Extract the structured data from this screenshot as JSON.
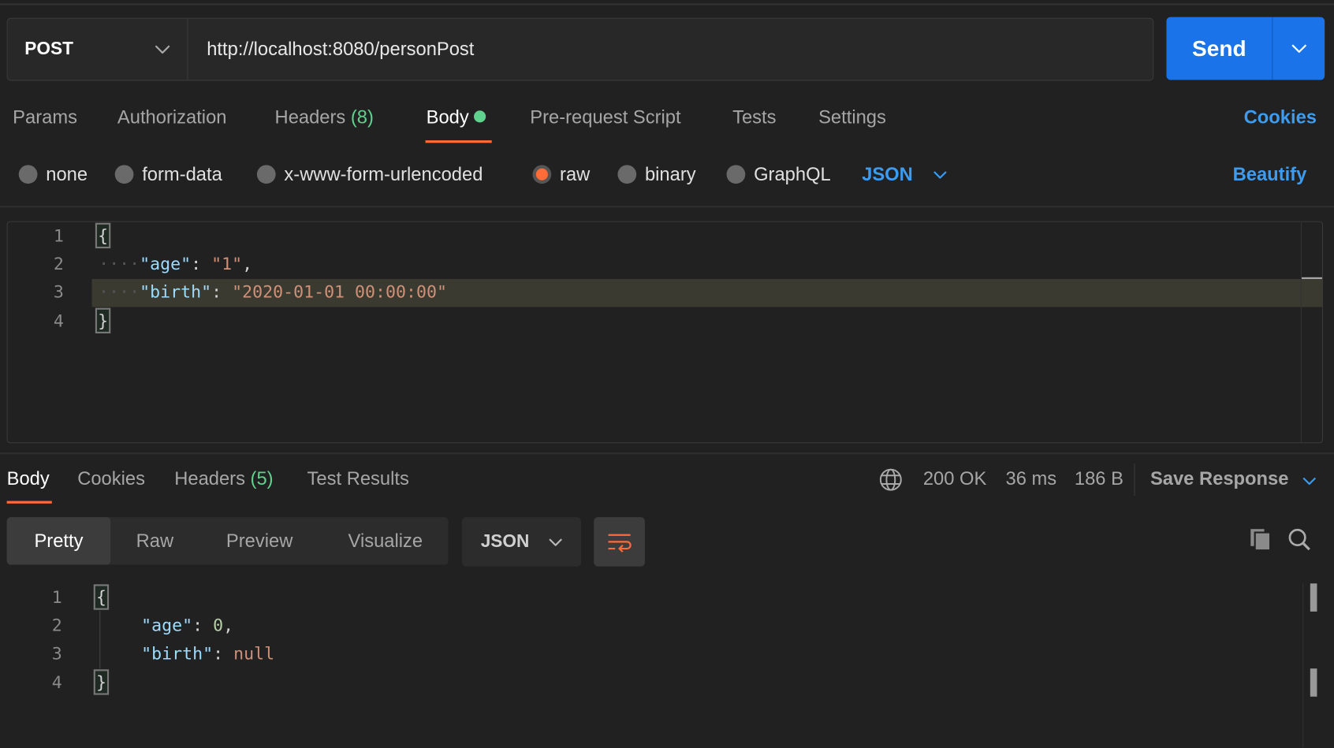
{
  "request": {
    "method": "POST",
    "url": "http://localhost:8080/personPost",
    "send_label": "Send"
  },
  "tabs": [
    {
      "label": "Params"
    },
    {
      "label": "Authorization"
    },
    {
      "label": "Headers",
      "count": "(8)"
    },
    {
      "label": "Body"
    },
    {
      "label": "Pre-request Script"
    },
    {
      "label": "Tests"
    },
    {
      "label": "Settings"
    }
  ],
  "cookies_label": "Cookies",
  "body_types": [
    "none",
    "form-data",
    "x-www-form-urlencoded",
    "raw",
    "binary",
    "GraphQL"
  ],
  "selected_body_type": "raw",
  "language": "JSON",
  "beautify_label": "Beautify",
  "request_body": {
    "line_numbers": [
      "1",
      "2",
      "3",
      "4"
    ],
    "open": "{",
    "close": "}",
    "age_key": "\"age\"",
    "age_val": "\"1\"",
    "birth_key": "\"birth\"",
    "birth_val": "\"2020-01-01 00:00:00\""
  },
  "response": {
    "tabs": [
      {
        "label": "Body"
      },
      {
        "label": "Cookies"
      },
      {
        "label": "Headers",
        "count": "(5)"
      },
      {
        "label": "Test Results"
      }
    ],
    "status": "200 OK",
    "time": "36 ms",
    "size": "186 B",
    "save_label": "Save Response",
    "views": [
      "Pretty",
      "Raw",
      "Preview",
      "Visualize"
    ],
    "format": "JSON",
    "body": {
      "line_numbers": [
        "1",
        "2",
        "3",
        "4"
      ],
      "open": "{",
      "close": "}",
      "age_key": "\"age\"",
      "age_val": "0",
      "birth_key": "\"birth\"",
      "birth_val": "null"
    }
  },
  "colors": {
    "accent": "#ff6c37",
    "send": "#1a73e8",
    "link": "#3d9bf0",
    "success": "#5fd38d"
  }
}
